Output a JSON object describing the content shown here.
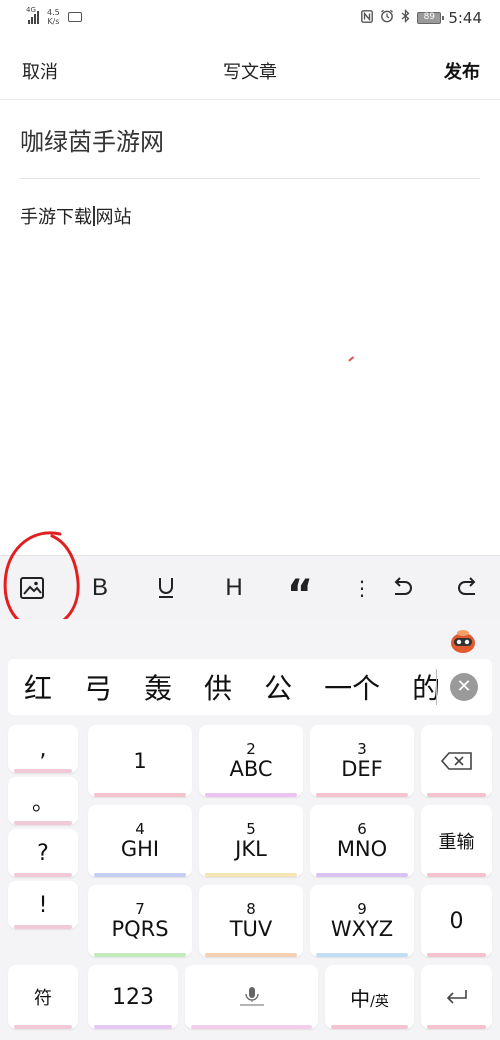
{
  "status_bar": {
    "network": "4G",
    "speed_value": "4.5",
    "speed_unit": "K/s",
    "time": "5:44",
    "battery": "89",
    "icons": [
      "signal-icon",
      "keyboard-icon",
      "nfc-icon",
      "alarm-icon",
      "bluetooth-icon",
      "battery-icon"
    ]
  },
  "nav": {
    "cancel_label": "取消",
    "title": "写文章",
    "publish_label": "发布"
  },
  "editor": {
    "title_value": "咖绿茵手游网",
    "body_before_caret": "手游下载",
    "body_after_caret": "网站"
  },
  "toolbar": {
    "bold_label": "B",
    "underline_label": "U",
    "heading_label": "H",
    "quote_label": "“",
    "list_label": "⋮",
    "undo_label": "↶",
    "redo_label": "↷",
    "icons": [
      "image-icon",
      "undo-icon",
      "redo-icon"
    ]
  },
  "ime": {
    "candidates": [
      "红",
      "弓",
      "轰",
      "供",
      "公",
      "一个",
      "的"
    ],
    "close_label": "✕",
    "punctuation": [
      ",",
      "。",
      "?",
      "!"
    ],
    "keys": [
      {
        "num": "",
        "letters": "1"
      },
      {
        "num": "2",
        "letters": "ABC"
      },
      {
        "num": "3",
        "letters": "DEF"
      },
      {
        "num": "4",
        "letters": "GHI"
      },
      {
        "num": "5",
        "letters": "JKL"
      },
      {
        "num": "6",
        "letters": "MNO"
      },
      {
        "num": "7",
        "letters": "PQRS"
      },
      {
        "num": "8",
        "letters": "TUV"
      },
      {
        "num": "9",
        "letters": "WXYZ"
      }
    ],
    "reinput_label": "重输",
    "zero_label": "0",
    "symbol_label": "符",
    "numeric_label": "123",
    "lang_main": "中",
    "lang_sub": "/英"
  },
  "colors": {
    "annotation_circle": "#e02020",
    "toolbar_bg": "#f3f3f5",
    "keyboard_bg": "#f4f4f6"
  }
}
